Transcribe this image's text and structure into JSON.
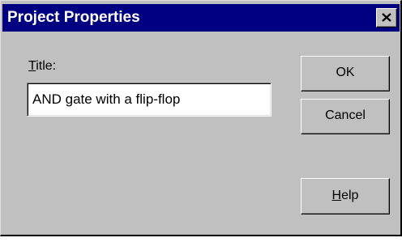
{
  "window": {
    "title": "Project Properties",
    "close_icon": "close-icon"
  },
  "form": {
    "title_label_mnemonic": "T",
    "title_label_rest": "itle:",
    "title_value": "AND gate with a flip-flop"
  },
  "buttons": {
    "ok_label": "OK",
    "cancel_label": "Cancel",
    "help_mnemonic": "H",
    "help_rest": "elp"
  },
  "colors": {
    "titlebar": "#000080",
    "face": "#c0c0c0"
  }
}
